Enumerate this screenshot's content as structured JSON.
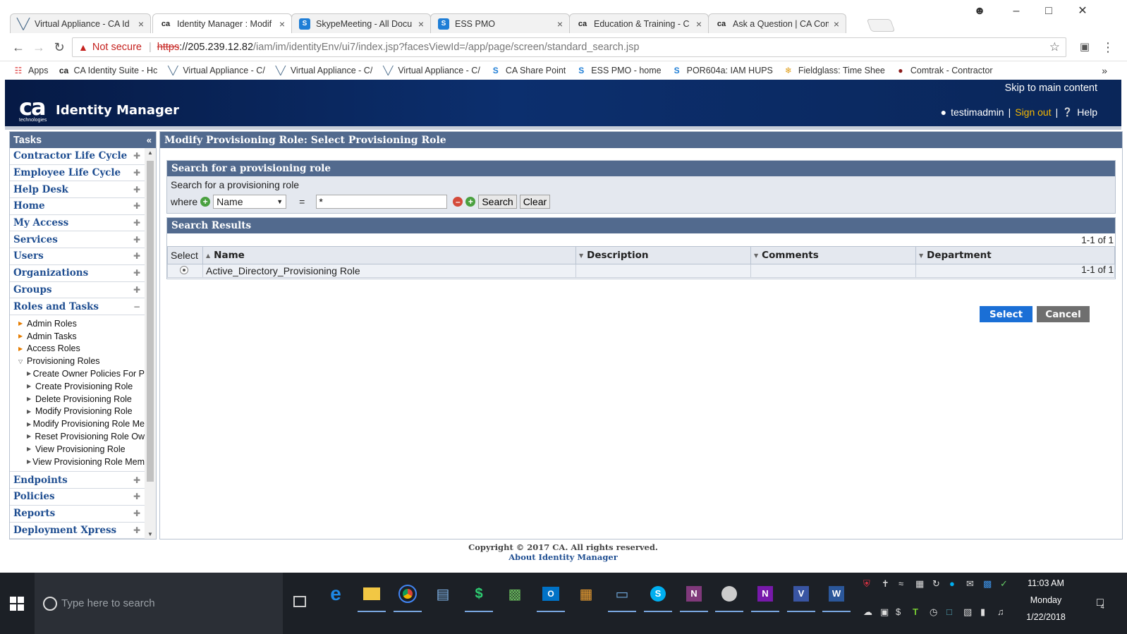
{
  "browser": {
    "tabs": [
      {
        "title": "Virtual Appliance - CA Id",
        "icon": "vmware-icon",
        "active": false
      },
      {
        "title": "Identity Manager : Modif",
        "icon": "ca-icon",
        "active": true
      },
      {
        "title": "SkypeMeeting - All Docu",
        "icon": "sharepoint-icon",
        "active": false
      },
      {
        "title": "ESS PMO",
        "icon": "sharepoint-icon",
        "active": false
      },
      {
        "title": "Education & Training - C",
        "icon": "ca-icon",
        "active": false
      },
      {
        "title": "Ask a Question | CA Com",
        "icon": "ca-icon",
        "active": false
      }
    ],
    "address": {
      "security_label": "Not secure",
      "scheme": "https",
      "host": "://205.239.12.82",
      "path": "/iam/im/identityEnv/ui7/index.jsp?facesViewId=/app/page/screen/standard_search.jsp"
    },
    "bookmarks": [
      {
        "label": "Apps",
        "icon": "apps-grid-icon"
      },
      {
        "label": "CA Identity Suite - Hc",
        "icon": "ca-icon"
      },
      {
        "label": "Virtual Appliance - C/",
        "icon": "vmware-icon"
      },
      {
        "label": "Virtual Appliance - C/",
        "icon": "vmware-icon"
      },
      {
        "label": "Virtual Appliance - C/",
        "icon": "vmware-icon"
      },
      {
        "label": "CA Share Point",
        "icon": "sharepoint-icon"
      },
      {
        "label": "ESS PMO - home",
        "icon": "sharepoint-icon"
      },
      {
        "label": "POR604a: IAM HUPS",
        "icon": "sharepoint-icon"
      },
      {
        "label": "Fieldglass: Time Shee",
        "icon": "fieldglass-icon"
      },
      {
        "label": "Comtrak - Contractor",
        "icon": "comtrak-icon"
      }
    ],
    "bookmarks_overflow": "»"
  },
  "header": {
    "logo_text": "ca",
    "logo_sub": "technologies",
    "app_title": "Identity Manager",
    "skip_link": "Skip to main content",
    "user": "testimadmin",
    "sign_out": "Sign out",
    "separator": "|",
    "help": "Help"
  },
  "tasks": {
    "title": "Tasks",
    "collapse_symbol": "«",
    "categories_top": [
      "Contractor Life Cycle",
      "Employee Life Cycle",
      "Help Desk",
      "Home",
      "My Access",
      "Services",
      "Users",
      "Organizations",
      "Groups"
    ],
    "expanded_category": "Roles and Tasks",
    "expanded_items": [
      {
        "label": "Admin Roles",
        "level": 1,
        "open": false
      },
      {
        "label": "Admin Tasks",
        "level": 1,
        "open": false
      },
      {
        "label": "Access Roles",
        "level": 1,
        "open": false
      },
      {
        "label": "Provisioning Roles",
        "level": 1,
        "open": true
      },
      {
        "label": "Create Owner Policies For P",
        "level": 2,
        "open": false
      },
      {
        "label": "Create Provisioning Role",
        "level": 2,
        "open": false
      },
      {
        "label": "Delete Provisioning Role",
        "level": 2,
        "open": false
      },
      {
        "label": "Modify Provisioning Role",
        "level": 2,
        "open": false
      },
      {
        "label": "Modify Provisioning Role Me",
        "level": 2,
        "open": false
      },
      {
        "label": "Reset Provisioning Role Ow",
        "level": 2,
        "open": false
      },
      {
        "label": "View Provisioning Role",
        "level": 2,
        "open": false
      },
      {
        "label": "View Provisioning Role Mem",
        "level": 2,
        "open": false
      }
    ],
    "categories_bottom": [
      "Endpoints",
      "Policies",
      "Reports",
      "Deployment Xpress"
    ]
  },
  "main": {
    "title": "Modify Provisioning Role: Select Provisioning Role",
    "search": {
      "heading": "Search for a provisioning role",
      "label": "Search for a provisioning role",
      "where": "where",
      "field": "Name",
      "operator": "=",
      "value": "*",
      "search_button": "Search",
      "clear_button": "Clear"
    },
    "results": {
      "heading": "Search Results",
      "page_info": "1-1 of 1",
      "columns": [
        "Select",
        "Name",
        "Description",
        "Comments",
        "Department"
      ],
      "rows": [
        {
          "name": "Active_Directory_Provisioning Role",
          "description": "",
          "comments": "",
          "department": ""
        }
      ]
    },
    "select_button": "Select",
    "cancel_button": "Cancel"
  },
  "footer": {
    "copyright": "Copyright © 2017 CA. All rights reserved.",
    "about": "About Identity Manager"
  },
  "taskbar": {
    "search_placeholder": "Type here to search",
    "time": "11:03 AM",
    "day": "Monday",
    "date": "1/22/2018",
    "notification_count": "4"
  }
}
